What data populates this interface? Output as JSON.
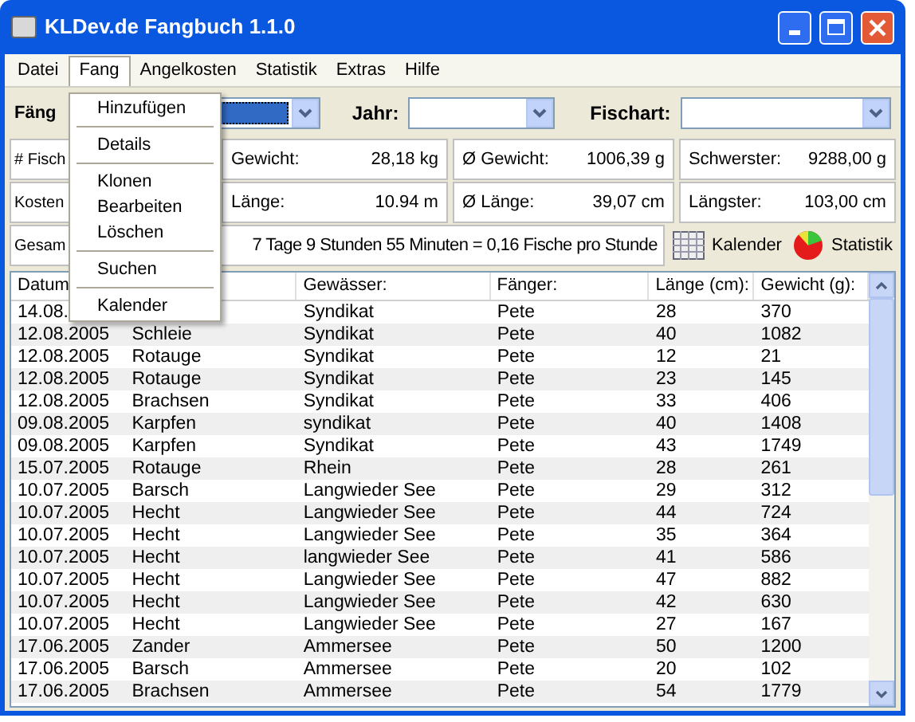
{
  "window": {
    "title": "KLDev.de Fangbuch 1.1.0"
  },
  "menu": [
    {
      "label": "Datei",
      "selected": false
    },
    {
      "label": "Fang",
      "selected": true
    },
    {
      "label": "Angelkosten",
      "selected": false
    },
    {
      "label": "Statistik",
      "selected": false
    },
    {
      "label": "Extras",
      "selected": false
    },
    {
      "label": "Hilfe",
      "selected": false
    }
  ],
  "dropdown": [
    {
      "label": "Hinzufügen",
      "separator_after": true
    },
    {
      "label": "Details",
      "separator_after": true
    },
    {
      "label": "Klonen",
      "separator_after": false
    },
    {
      "label": "Bearbeiten",
      "separator_after": false
    },
    {
      "label": "Löschen",
      "separator_after": true
    },
    {
      "label": "Suchen",
      "separator_after": true
    },
    {
      "label": "Kalender",
      "separator_after": false
    }
  ],
  "filters": {
    "faenger_label": "Fäng",
    "jahr_label": "Jahr:",
    "fischart_label": "Fischart:"
  },
  "stats": [
    [
      {
        "label": "# Fisch"
      },
      {
        "label": "Gewicht:",
        "value": "28,18 kg"
      },
      {
        "label": "Ø Gewicht:",
        "value": "1006,39 g"
      },
      {
        "label": "Schwerster:",
        "value": "9288,00 g"
      }
    ],
    [
      {
        "label": "Kosten"
      },
      {
        "label": "Länge:",
        "value": "10.94 m"
      },
      {
        "label": "Ø Länge:",
        "value": "39,07 cm"
      },
      {
        "label": "Längster:",
        "value": "103,00 cm"
      }
    ]
  ],
  "duration": {
    "label": "Gesam",
    "text": "7 Tage 9 Stunden 55 Minuten  =  0,16 Fische pro Stunde"
  },
  "buttons": [
    {
      "label": "Kalender",
      "kind": "calendar"
    },
    {
      "label": "Statistik",
      "kind": "chart"
    }
  ],
  "table": {
    "columns": [
      "Datum",
      null,
      "Gewässer:",
      "Fänger:",
      "Länge (cm):",
      "Gewicht (g):"
    ],
    "rows": [
      [
        "14.08.",
        null,
        "Syndikat",
        "Pete",
        "28",
        "370"
      ],
      [
        "12.08.2005",
        "Schleie",
        "Syndikat",
        "Pete",
        "40",
        "1082"
      ],
      [
        "12.08.2005",
        "Rotauge",
        "Syndikat",
        "Pete",
        "12",
        "21"
      ],
      [
        "12.08.2005",
        "Rotauge",
        "Syndikat",
        "Pete",
        "23",
        "145"
      ],
      [
        "12.08.2005",
        "Brachsen",
        "Syndikat",
        "Pete",
        "33",
        "406"
      ],
      [
        "09.08.2005",
        "Karpfen",
        "syndikat",
        "Pete",
        "40",
        "1408"
      ],
      [
        "09.08.2005",
        "Karpfen",
        "Syndikat",
        "Pete",
        "43",
        "1749"
      ],
      [
        "15.07.2005",
        "Rotauge",
        "Rhein",
        "Pete",
        "28",
        "261"
      ],
      [
        "10.07.2005",
        "Barsch",
        "Langwieder See",
        "Pete",
        "29",
        "312"
      ],
      [
        "10.07.2005",
        "Hecht",
        "Langwieder See",
        "Pete",
        "44",
        "724"
      ],
      [
        "10.07.2005",
        "Hecht",
        "Langwieder See",
        "Pete",
        "35",
        "364"
      ],
      [
        "10.07.2005",
        "Hecht",
        "langwieder See",
        "Pete",
        "41",
        "586"
      ],
      [
        "10.07.2005",
        "Hecht",
        "Langwieder See",
        "Pete",
        "47",
        "882"
      ],
      [
        "10.07.2005",
        "Hecht",
        "Langwieder See",
        "Pete",
        "42",
        "630"
      ],
      [
        "10.07.2005",
        "Hecht",
        "Langwieder See",
        "Pete",
        "27",
        "167"
      ],
      [
        "17.06.2005",
        "Zander",
        "Ammersee",
        "Pete",
        "50",
        "1200"
      ],
      [
        "17.06.2005",
        "Barsch",
        "Ammersee",
        "Pete",
        "20",
        "102"
      ],
      [
        "17.06.2005",
        "Brachsen",
        "Ammersee",
        "Pete",
        "54",
        "1779"
      ]
    ]
  }
}
